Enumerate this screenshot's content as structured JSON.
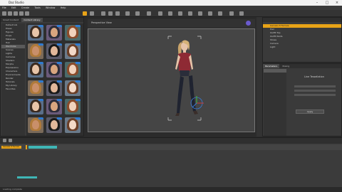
{
  "app": {
    "title": "Daz Studio"
  },
  "menu": [
    "File",
    "Edit",
    "Create",
    "Tools",
    "Window",
    "Help"
  ],
  "content_library": {
    "tabs": [
      "Smart Content",
      "Content Library"
    ],
    "categories": [
      "Default Lib",
      "Poses",
      "Figures",
      "Props",
      "Materials",
      "Hair",
      "Wardrobe",
      "Scenes",
      "Lights",
      "Cameras",
      "Shaders",
      "Morphs",
      "Expressions",
      "Characters",
      "Environments",
      "Render",
      "Tutorials",
      "My Library",
      "Favorites"
    ]
  },
  "viewport": {
    "camera": "Perspective View",
    "tool": "Universal"
  },
  "scene": {
    "items": [
      "Genesis 8 Female",
      "Hair",
      "Outfit Top",
      "Outfit Pants",
      "Shoes",
      "Camera",
      "Light"
    ]
  },
  "parameters": {
    "tabs": [
      "Parameters",
      "Posing"
    ],
    "heading": "Line Tessellation",
    "button": "Apply"
  },
  "timeline": {
    "track": "Genesis 8 Female"
  },
  "status": "Loading complete",
  "colors": {
    "accent": "#e8a317",
    "selection": "#2f7bd0",
    "viewport_bg": "#454545"
  }
}
